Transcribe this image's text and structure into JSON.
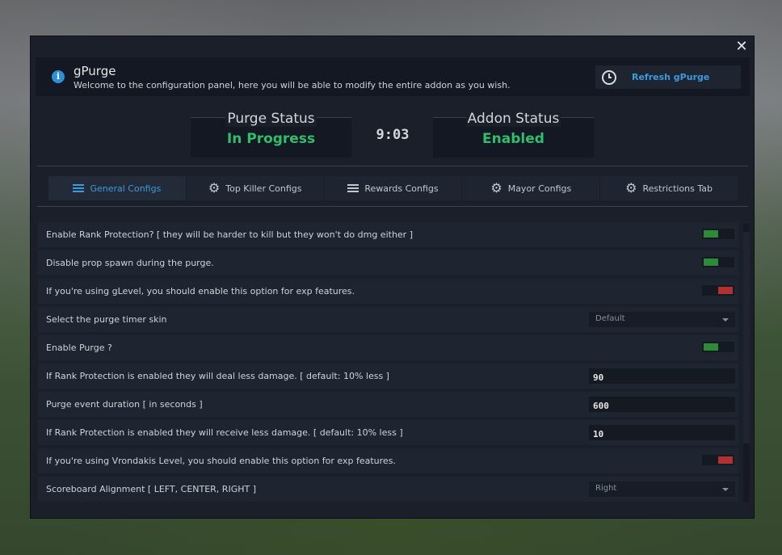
{
  "app": {
    "title": "gPurge",
    "subtitle": "Welcome to the configuration panel, here you will be able to modify the entire addon as you wish.",
    "refresh_label": "Refresh gPurge"
  },
  "status": {
    "purge_title": "Purge Status",
    "purge_value": "In Progress",
    "addon_title": "Addon Status",
    "addon_value": "Enabled",
    "timer": "9:03"
  },
  "tabs": [
    {
      "label": "General Configs",
      "icon": "menu-icon",
      "active": true
    },
    {
      "label": "Top Killer Configs",
      "icon": "gear-icon",
      "active": false
    },
    {
      "label": "Rewards Configs",
      "icon": "menu-icon",
      "active": false
    },
    {
      "label": "Mayor Configs",
      "icon": "gear-icon",
      "active": false
    },
    {
      "label": "Restrictions Tab",
      "icon": "gear-icon",
      "active": false
    }
  ],
  "settings": [
    {
      "label": "Enable Rank Protection? [ they will be harder to kill but they won't do dmg either ]",
      "control": "toggle",
      "value": true
    },
    {
      "label": "Disable prop spawn during the purge.",
      "control": "toggle",
      "value": true
    },
    {
      "label": "If you're using gLevel, you should enable this option for exp features.",
      "control": "toggle",
      "value": false
    },
    {
      "label": "Select the purge timer skin",
      "control": "select",
      "value": "Default"
    },
    {
      "label": "Enable Purge ?",
      "control": "toggle",
      "value": true
    },
    {
      "label": "If Rank Protection is enabled they will deal less damage. [ default: 10% less ]",
      "control": "number",
      "value": "90"
    },
    {
      "label": "Purge event duration [ in seconds ]",
      "control": "number",
      "value": "600"
    },
    {
      "label": "If Rank Protection is enabled they will receive less damage. [ default: 10% less ]",
      "control": "number",
      "value": "10"
    },
    {
      "label": "If you're using Vrondakis Level, you should enable this option for exp features.",
      "control": "toggle",
      "value": false
    },
    {
      "label": "Scoreboard Alignment [ LEFT, CENTER, RIGHT ]",
      "control": "select",
      "value": "Right"
    }
  ],
  "colors": {
    "accent": "#3a9be0",
    "status_green": "#2fbf6a",
    "toggle_on": "#2c8a38",
    "toggle_off": "#b23030"
  },
  "icons": {
    "close": "close-icon",
    "info": "info-icon",
    "refresh": "clock-icon"
  }
}
